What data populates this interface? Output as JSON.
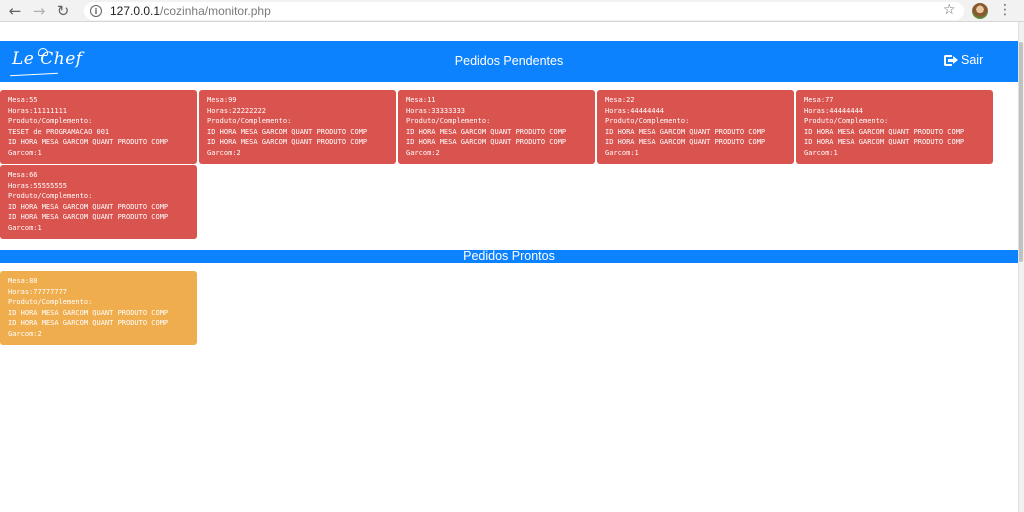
{
  "browser": {
    "url_host": "127.0.0.1",
    "url_path": "/cozinha/monitor.php"
  },
  "header": {
    "logo_text": "Le Chef",
    "title": "Pedidos Pendentes",
    "logout_label": "Sair"
  },
  "ready_section": {
    "title": "Pedidos Prontos"
  },
  "pending_orders": [
    {
      "mesa": "Mesa:55",
      "horas": "Horas:11111111",
      "produto_label": "Produto/Complemento:",
      "item1": "TESET de PROGRAMACAO 001",
      "item2": "ID HORA MESA GARCOM QUANT PRODUTO COMP",
      "garcom": "Garcom:1"
    },
    {
      "mesa": "Mesa:99",
      "horas": "Horas:22222222",
      "produto_label": "Produto/Complemento:",
      "item1": "ID HORA MESA GARCOM QUANT PRODUTO COMP",
      "item2": "ID HORA MESA GARCOM QUANT PRODUTO COMP",
      "garcom": "Garcom:2"
    },
    {
      "mesa": "Mesa:11",
      "horas": "Horas:33333333",
      "produto_label": "Produto/Complemento:",
      "item1": "ID HORA MESA GARCOM QUANT PRODUTO COMP",
      "item2": "ID HORA MESA GARCOM QUANT PRODUTO COMP",
      "garcom": "Garcom:2"
    },
    {
      "mesa": "Mesa:22",
      "horas": "Horas:44444444",
      "produto_label": "Produto/Complemento:",
      "item1": "ID HORA MESA GARCOM QUANT PRODUTO COMP",
      "item2": "ID HORA MESA GARCOM QUANT PRODUTO COMP",
      "garcom": "Garcom:1"
    },
    {
      "mesa": "Mesa:77",
      "horas": "Horas:44444444",
      "produto_label": "Produto/Complemento:",
      "item1": "ID HORA MESA GARCOM QUANT PRODUTO COMP",
      "item2": "ID HORA MESA GARCOM QUANT PRODUTO COMP",
      "garcom": "Garcom:1"
    },
    {
      "mesa": "Mesa:66",
      "horas": "Horas:55555555",
      "produto_label": "Produto/Complemento:",
      "item1": "ID HORA MESA GARCOM QUANT PRODUTO COMP",
      "item2": "ID HORA MESA GARCOM QUANT PRODUTO COMP",
      "garcom": "Garcom:1"
    }
  ],
  "ready_orders": [
    {
      "mesa": "Mesa:88",
      "horas": "Horas:77777777",
      "produto_label": "Produto/Complemento:",
      "item1": "ID HORA MESA GARCOM QUANT PRODUTO COMP",
      "item2": "ID HORA MESA GARCOM QUANT PRODUTO COMP",
      "garcom": "Garcom:2"
    }
  ],
  "colors": {
    "header_blue": "#0d82ff",
    "pending_red": "#d9534f",
    "ready_orange": "#f0ad4e"
  }
}
